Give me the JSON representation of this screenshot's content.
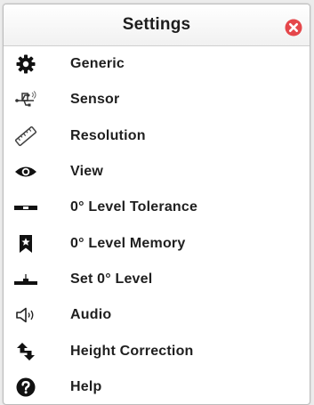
{
  "header": {
    "title": "Settings",
    "close_icon": "close-icon",
    "close_color": "#e5474b"
  },
  "menu": {
    "items": [
      {
        "label": "Generic",
        "icon": "gear-icon"
      },
      {
        "label": "Sensor",
        "icon": "usb-sensor-icon"
      },
      {
        "label": "Resolution",
        "icon": "ruler-icon"
      },
      {
        "label": "View",
        "icon": "eye-icon"
      },
      {
        "label": "0° Level Tolerance",
        "icon": "level-tolerance-icon"
      },
      {
        "label": "0° Level Memory",
        "icon": "bookmark-star-icon"
      },
      {
        "label": "Set 0° Level",
        "icon": "set-level-icon"
      },
      {
        "label": "Audio",
        "icon": "speaker-icon"
      },
      {
        "label": "Height Correction",
        "icon": "height-correction-icon"
      },
      {
        "label": "Help",
        "icon": "help-icon"
      }
    ]
  }
}
